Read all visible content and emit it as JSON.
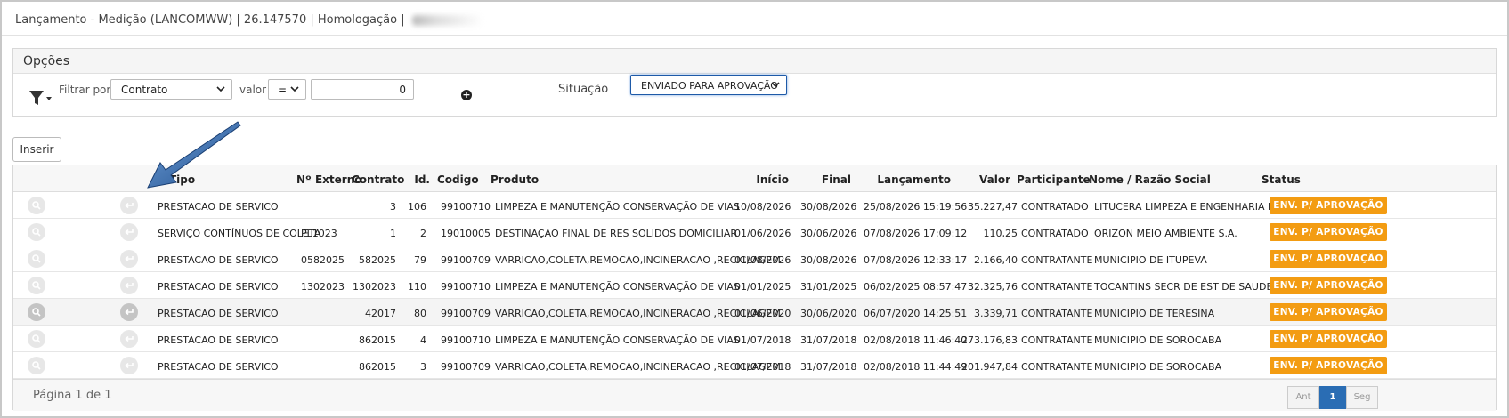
{
  "window": {
    "title": "Lançamento - Medição (LANCOMWW) | 26.147570 | Homologação |"
  },
  "options": {
    "header": "Opções",
    "filter_label": "Filtrar por",
    "filter_field": "Contrato",
    "value_label": "valor",
    "operator": "=",
    "value": "0",
    "situation_label": "Situação",
    "situation": "ENVIADO PARA APROVAÇÃO"
  },
  "toolbar": {
    "insert_label": "Inserir"
  },
  "table": {
    "headers": {
      "tipo": "Tipo",
      "externo": "Nº Externo",
      "contrato": "Contrato",
      "id": "Id.",
      "codigo": "Codigo",
      "produto": "Produto",
      "inicio": "Início",
      "final": "Final",
      "lancamento": "Lançamento",
      "valor": "Valor",
      "participante": "Participante",
      "nome": "Nome / Razão Social",
      "status": "Status"
    },
    "rows": [
      {
        "tipo": "PRESTACAO DE SERVICO",
        "externo": "",
        "contrato": "3",
        "id": "106",
        "codigo": "99100710",
        "produto": "LIMPEZA E MANUTENÇÃO CONSERVAÇÃO DE VIAS",
        "inicio": "10/08/2026",
        "final": "30/08/2026",
        "lancamento": "25/08/2026 15:19:56",
        "valor": "35.227,47",
        "participante": "CONTRATADO",
        "nome": "LITUCERA LIMPEZA E ENGENHARIA LTDA",
        "status": "ENV. P/ APROVAÇÃO"
      },
      {
        "tipo": "SERVIÇO CONTÍNUOS DE COLETA",
        "externo": "PL1023",
        "contrato": "1",
        "id": "2",
        "codigo": "19010005",
        "produto": "DESTINAÇAO FINAL DE RES SOLIDOS DOMICILIAR",
        "inicio": "01/06/2026",
        "final": "30/06/2026",
        "lancamento": "07/08/2026 17:09:12",
        "valor": "110,25",
        "participante": "CONTRATADO",
        "nome": "ORIZON MEIO AMBIENTE S.A.",
        "status": "ENV. P/ APROVAÇÃO"
      },
      {
        "tipo": "PRESTACAO DE SERVICO",
        "externo": "0582025",
        "contrato": "582025",
        "id": "79",
        "codigo": "99100709",
        "produto": "VARRICAO,COLETA,REMOCAO,INCINERACAO ,RECICLAGEM",
        "inicio": "01/08/2026",
        "final": "30/08/2026",
        "lancamento": "07/08/2026 12:33:17",
        "valor": "2.166,40",
        "participante": "CONTRATANTE",
        "nome": "MUNICIPIO DE ITUPEVA",
        "status": "ENV. P/ APROVAÇÃO"
      },
      {
        "tipo": "PRESTACAO DE SERVICO",
        "externo": "1302023",
        "contrato": "1302023",
        "id": "110",
        "codigo": "99100710",
        "produto": "LIMPEZA E MANUTENÇÃO CONSERVAÇÃO DE VIAS",
        "inicio": "01/01/2025",
        "final": "31/01/2025",
        "lancamento": "06/02/2025 08:57:47",
        "valor": "32.325,76",
        "participante": "CONTRATANTE",
        "nome": "TOCANTINS SECR DE EST DE SAUDE",
        "status": "ENV. P/ APROVAÇÃO"
      },
      {
        "tipo": "PRESTACAO DE SERVICO",
        "externo": "",
        "contrato": "42017",
        "id": "80",
        "codigo": "99100709",
        "produto": "VARRICAO,COLETA,REMOCAO,INCINERACAO ,RECICLAGEM",
        "inicio": "01/06/2020",
        "final": "30/06/2020",
        "lancamento": "06/07/2020 14:25:51",
        "valor": "3.339,71",
        "participante": "CONTRATANTE",
        "nome": "MUNICIPIO DE TERESINA",
        "status": "ENV. P/ APROVAÇÃO"
      },
      {
        "tipo": "PRESTACAO DE SERVICO",
        "externo": "",
        "contrato": "862015",
        "id": "4",
        "codigo": "99100710",
        "produto": "LIMPEZA E MANUTENÇÃO CONSERVAÇÃO DE VIAS",
        "inicio": "01/07/2018",
        "final": "31/07/2018",
        "lancamento": "02/08/2018 11:46:40",
        "valor": "273.176,83",
        "participante": "CONTRATANTE",
        "nome": "MUNICIPIO DE SOROCABA",
        "status": "ENV. P/ APROVAÇÃO"
      },
      {
        "tipo": "PRESTACAO DE SERVICO",
        "externo": "",
        "contrato": "862015",
        "id": "3",
        "codigo": "99100709",
        "produto": "VARRICAO,COLETA,REMOCAO,INCINERACAO ,RECICLAGEM",
        "inicio": "01/07/2018",
        "final": "31/07/2018",
        "lancamento": "02/08/2018 11:44:49",
        "valor": "201.947,84",
        "participante": "CONTRATANTE",
        "nome": "MUNICIPIO DE SOROCABA",
        "status": "ENV. P/ APROVAÇÃO"
      }
    ]
  },
  "footer": {
    "page_info": "Página 1 de 1",
    "prev": "Ant",
    "current": "1",
    "next": "Seg"
  },
  "colors": {
    "status_badge": "#f39c12",
    "pager_active": "#2a6db4",
    "annotation_arrow": "#1f4e8c"
  }
}
